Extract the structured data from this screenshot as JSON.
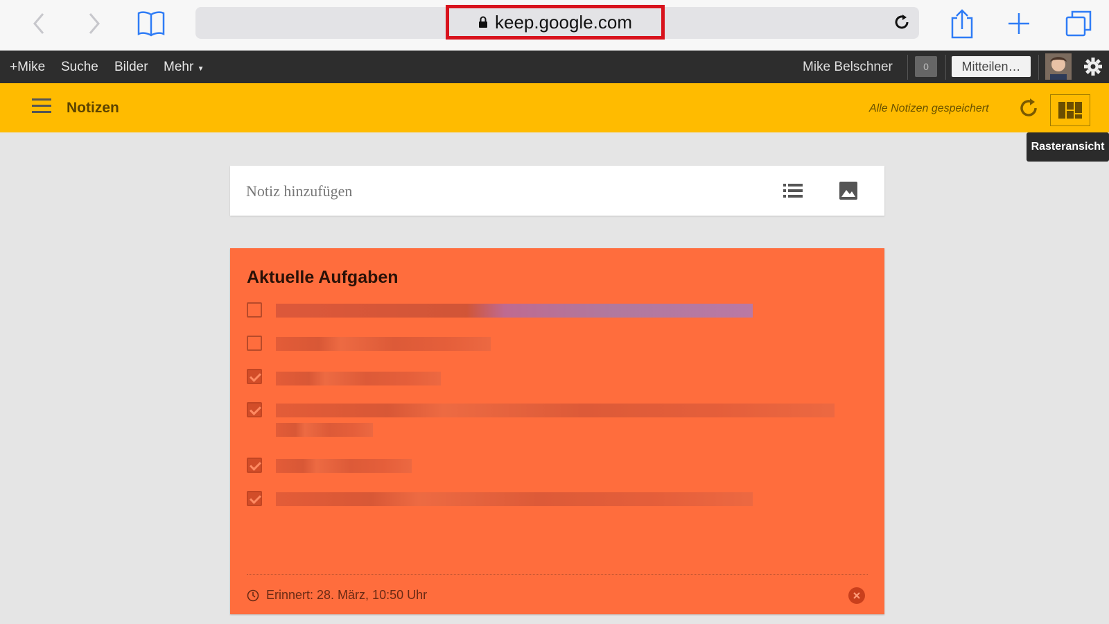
{
  "browser": {
    "url": "keep.google.com"
  },
  "gbar": {
    "links": [
      "+Mike",
      "Suche",
      "Bilder",
      "Mehr"
    ],
    "user_name": "Mike Belschner",
    "notification_count": "0",
    "share_label": "Mitteilen…"
  },
  "keep": {
    "title": "Notizen",
    "save_status": "Alle Notizen gespeichert",
    "grid_view_tooltip": "Rasteransicht"
  },
  "add_note": {
    "placeholder": "Notiz hinzufügen"
  },
  "note": {
    "title": "Aktuelle Aufgaben",
    "items": [
      {
        "text": "A",
        "checked": false
      },
      {
        "text": "Y",
        "checked": false
      },
      {
        "text": "V",
        "checked": true
      },
      {
        "text": "E",
        "checked": true
      },
      {
        "text": "E",
        "checked": true
      },
      {
        "text": "E",
        "checked": true
      }
    ],
    "reminder": "Erinnert: 28. März, 10:50 Uhr"
  },
  "colors": {
    "keep_yellow": "#ffbb00",
    "note_orange": "#ff6d3d",
    "url_highlight": "#d8121c"
  }
}
